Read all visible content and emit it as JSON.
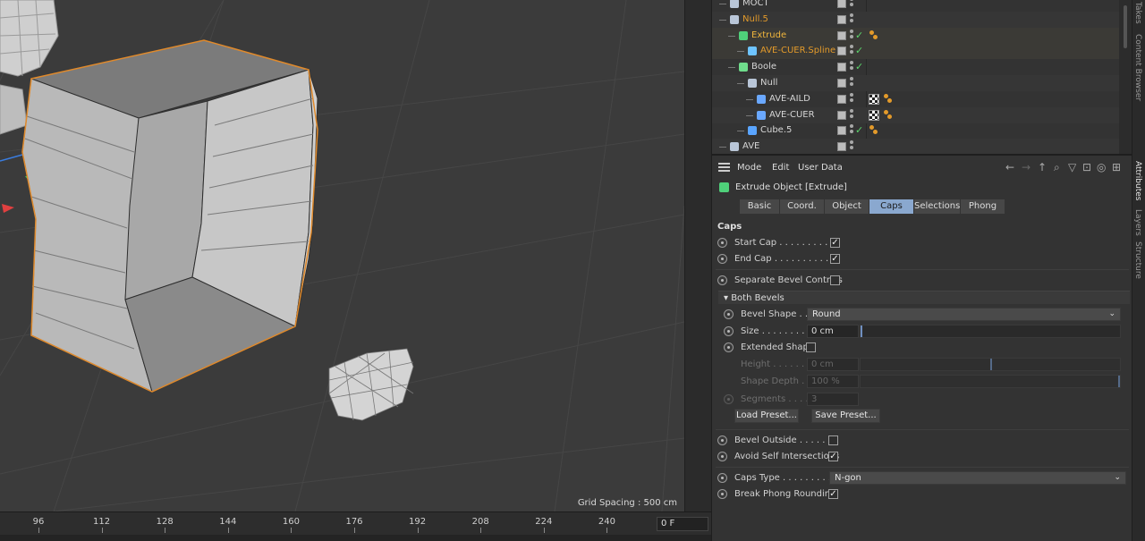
{
  "viewport": {
    "grid_spacing_label": "Grid Spacing : 500 cm"
  },
  "timeline": {
    "ticks": [
      "96",
      "112",
      "128",
      "144",
      "160",
      "176",
      "192",
      "208",
      "224",
      "240"
    ],
    "current_frame": "0 F"
  },
  "object_manager": {
    "rows": [
      {
        "name": "MOCT",
        "color": "#d6d6d6",
        "icon": "null-icon",
        "indent": 0,
        "check": false,
        "tags": "none"
      },
      {
        "name": "Null.5",
        "color": "#e39a2a",
        "icon": "null-icon",
        "indent": 0,
        "check": false,
        "tags": "none"
      },
      {
        "name": "Extrude",
        "color": "#f0b53c",
        "icon": "extrude-icon",
        "indent": 1,
        "check": true,
        "tags": "orange"
      },
      {
        "name": "AVE-CUER.Spline",
        "color": "#e39a2a",
        "icon": "spline-icon",
        "indent": 2,
        "check": true,
        "tags": "none"
      },
      {
        "name": "Boole",
        "color": "#d6d6d6",
        "icon": "boole-icon",
        "indent": 1,
        "check": true,
        "tags": "none"
      },
      {
        "name": "Null",
        "color": "#d6d6d6",
        "icon": "null-icon",
        "indent": 2,
        "check": false,
        "tags": "none"
      },
      {
        "name": "AVE-AILD",
        "color": "#d6d6d6",
        "icon": "polygon-icon",
        "indent": 3,
        "check": false,
        "tags": "checker-orange"
      },
      {
        "name": "AVE-CUER",
        "color": "#d6d6d6",
        "icon": "polygon-icon",
        "indent": 3,
        "check": false,
        "tags": "checker-orange"
      },
      {
        "name": "Cube.5",
        "color": "#d6d6d6",
        "icon": "cube-icon",
        "indent": 2,
        "check": true,
        "tags": "orange"
      },
      {
        "name": "AVE",
        "color": "#d6d6d6",
        "icon": "null-icon",
        "indent": 0,
        "check": false,
        "tags": "none"
      }
    ]
  },
  "side_tabs": {
    "takes": "Takes",
    "content_browser": "Content Browser",
    "attributes": "Attributes",
    "layers": "Layers",
    "structure": "Structure"
  },
  "attributes": {
    "menu": {
      "mode": "Mode",
      "edit": "Edit",
      "user_data": "User Data"
    },
    "object_title": "Extrude Object [Extrude]",
    "tabs": [
      "Basic",
      "Coord.",
      "Object",
      "Caps",
      "Selections",
      "Phong"
    ],
    "active_tab": "Caps",
    "section_title": "Caps",
    "start_cap_label": "Start Cap . . . . . . . . . .",
    "start_cap_checked": true,
    "end_cap_label": "End Cap . . . . . . . . . . .",
    "end_cap_checked": true,
    "separate_bevel_label": "Separate Bevel Controls",
    "separate_bevel_checked": false,
    "both_bevels_label": "▾ Both Bevels",
    "bevel_shape_label": "Bevel Shape . . .",
    "bevel_shape_value": "Round",
    "size_label": "Size . . . . . . . . .",
    "size_value": "0 cm",
    "extended_shape_label": "Extended Shape",
    "extended_shape_checked": false,
    "height_label": "Height . . . . . . .",
    "height_value": "0 cm",
    "shape_depth_label": "Shape Depth . .",
    "shape_depth_value": "100 %",
    "segments_label": "Segments . . . .",
    "segments_value": "3",
    "load_preset_label": "Load Preset...",
    "save_preset_label": "Save Preset...",
    "bevel_outside_label": "Bevel Outside . . . . . .",
    "bevel_outside_checked": false,
    "avoid_self_label": "Avoid Self Intersections",
    "avoid_self_checked": true,
    "caps_type_label": "Caps Type . . . . . . . . .",
    "caps_type_value": "N-gon",
    "break_phong_label": "Break Phong Rounding",
    "break_phong_checked": true,
    "accent_color": "#8aa8cf"
  }
}
